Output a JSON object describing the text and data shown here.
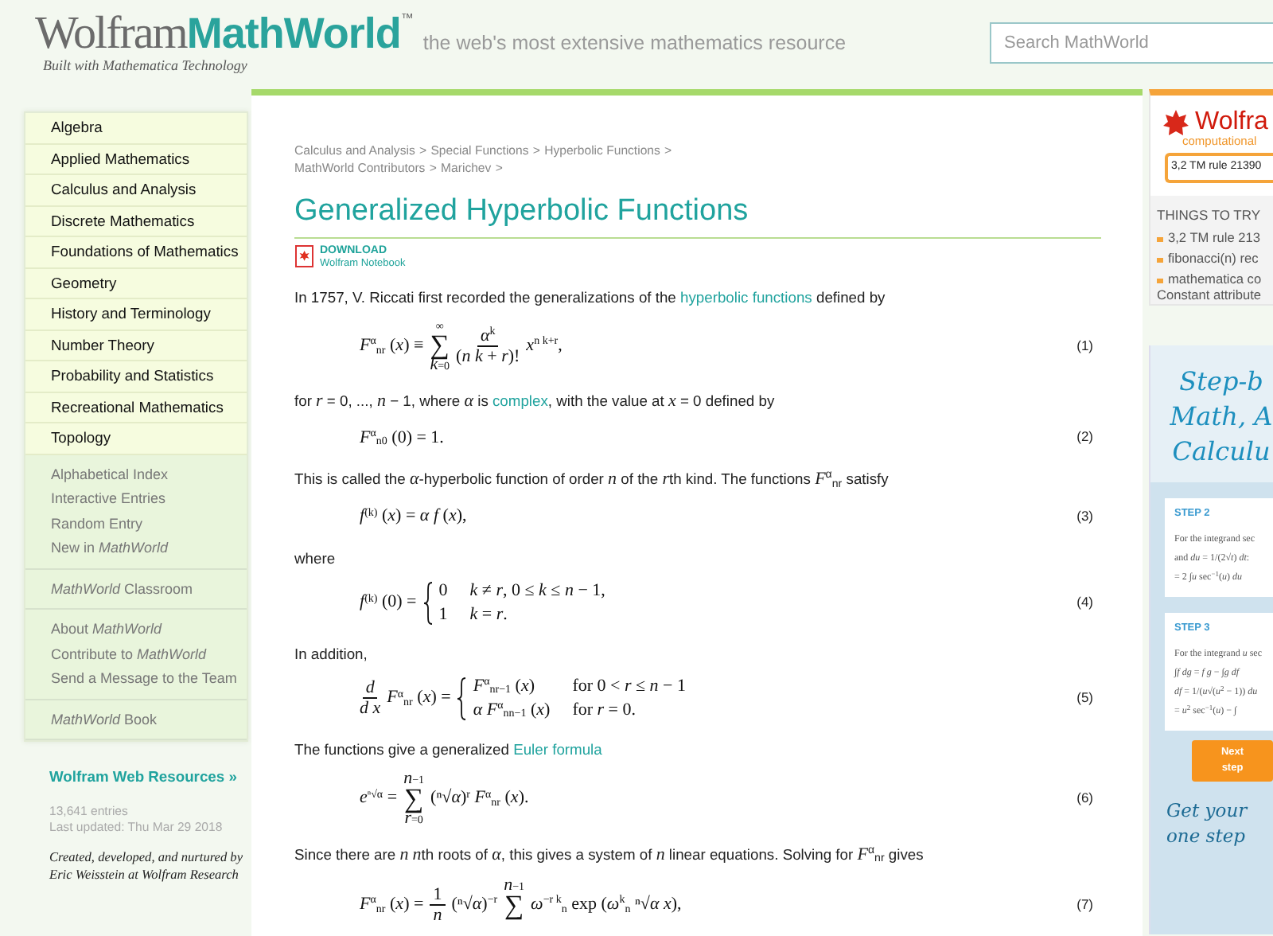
{
  "header": {
    "logo_wolfram": "Wolfram",
    "logo_mathworld": "MathWorld",
    "trademark": "™",
    "logo_tagline": "Built with Mathematica Technology",
    "tagline": "the web's most extensive mathematics resource",
    "search": {
      "placeholder": "Search MathWorld"
    }
  },
  "sidebar": {
    "topics": [
      "Algebra",
      "Applied Mathematics",
      "Calculus and Analysis",
      "Discrete Mathematics",
      "Foundations of Mathematics",
      "Geometry",
      "History and Terminology",
      "Number Theory",
      "Probability and Statistics",
      "Recreational Mathematics",
      "Topology"
    ],
    "link_groups": [
      [
        "Alphabetical Index",
        "Interactive Entries",
        "Random Entry",
        "New in *MathWorld*"
      ],
      [
        "*MathWorld* Classroom"
      ],
      [
        "About *MathWorld*",
        "Contribute to *MathWorld*",
        "Send a Message to the Team"
      ],
      [
        "*MathWorld* Book"
      ]
    ],
    "resources": "Wolfram Web Resources »",
    "entries": "13,641 entries",
    "updated": "Last updated: Thu Mar 29 2018",
    "credit": "Created, developed, and nurtured by Eric Weisstein at Wolfram Research"
  },
  "article": {
    "breadcrumb": [
      [
        {
          "label": "Calculus and Analysis",
          "separator": ">"
        },
        {
          "label": "Special Functions",
          "separator": ">"
        },
        {
          "label": "Hyperbolic Functions",
          "separator": ">"
        }
      ],
      [
        {
          "label": "MathWorld Contributors",
          "separator": ">"
        },
        {
          "label": "Marichev",
          "separator": ">"
        }
      ]
    ],
    "title": "Generalized Hyperbolic Functions",
    "download": {
      "label": "DOWNLOAD",
      "sublabel": "Wolfram Notebook"
    },
    "blocks": [
      {
        "kind": "para",
        "parts": [
          {
            "kind": "text",
            "text": "In 1757, V. Riccati first recorded the generalizations of the "
          },
          {
            "kind": "link",
            "text": "hyperbolic functions"
          },
          {
            "kind": "text",
            "text": " defined by"
          }
        ]
      },
      {
        "kind": "equation",
        "number": "(1)",
        "parts": [
          {
            "kind": "text",
            "text": "*F*$^{α}$$_{nr}$ (*x*) ≡"
          },
          {
            "kind": "sum",
            "symbol": "∑",
            "upper": "∞",
            "lower": "*k*=0"
          },
          {
            "kind": "frac",
            "num": "*α*$^{k}$",
            "den": "(*n k* + *r*)!"
          },
          {
            "kind": "text",
            "text": "*x*$^{n k+r}$,"
          }
        ]
      },
      {
        "kind": "para",
        "parts": [
          {
            "kind": "text",
            "text": "for *r* = 0, ..., *n* − 1, where *α* is "
          },
          {
            "kind": "link",
            "text": "complex"
          },
          {
            "kind": "text",
            "text": ", with the value at *x* = 0 defined by"
          }
        ]
      },
      {
        "kind": "equation",
        "number": "(2)",
        "parts": [
          {
            "kind": "text",
            "text": "*F*$^{α}$$_{n0}$ (0) = 1."
          }
        ]
      },
      {
        "kind": "para",
        "parts": [
          {
            "kind": "text",
            "text": "This is called the *α*-hyperbolic function of order *n* of the "
          },
          {
            "kind": "var",
            "text": "r"
          },
          {
            "kind": "text",
            "text": "th kind. The functions *F*$^{α}$$_{nr}$ satisfy"
          }
        ]
      },
      {
        "kind": "equation",
        "number": "(3)",
        "parts": [
          {
            "kind": "text",
            "text": "*f*$^{(k)}$ (*x*) = *α f* (*x*),"
          }
        ]
      },
      {
        "kind": "para",
        "parts": [
          {
            "kind": "text",
            "text": "where"
          }
        ]
      },
      {
        "kind": "equation",
        "number": "(4)",
        "parts": [
          {
            "kind": "text",
            "text": "*f*$^{(k)}$ (0) ="
          },
          {
            "kind": "cases",
            "rows": [
              [
                "0",
                "*k* ≠ *r*, 0 ≤ *k* ≤ *n* − 1,"
              ],
              [
                "1",
                "*k* = *r*."
              ]
            ]
          }
        ]
      },
      {
        "kind": "para",
        "parts": [
          {
            "kind": "text",
            "text": "In addition,"
          }
        ]
      },
      {
        "kind": "equation",
        "number": "(5)",
        "parts": [
          {
            "kind": "frac",
            "num": "*d*",
            "den": "*d x*"
          },
          {
            "kind": "text",
            "text": "*F*$^{α}$$_{nr}$ (*x*) ="
          },
          {
            "kind": "cases",
            "rows": [
              [
                "*F*$^{α}$$_{nr−1}$ (*x*)",
                "for 0 < *r* ≤ *n* − 1"
              ],
              [
                "*α F*$^{α}$$_{nn−1}$ (*x*)",
                "for *r* = 0."
              ]
            ]
          }
        ]
      },
      {
        "kind": "para",
        "parts": [
          {
            "kind": "text",
            "text": "The functions give a generalized "
          },
          {
            "kind": "link",
            "text": "Euler formula"
          }
        ]
      },
      {
        "kind": "equation",
        "number": "(6)",
        "parts": [
          {
            "kind": "text",
            "text": "*e*$^{ⁿ√α}$ ="
          },
          {
            "kind": "sum",
            "symbol": "∑",
            "upper": "*n*−1",
            "lower": "*r*=0"
          },
          {
            "kind": "text",
            "text": "(ⁿ√*α*)$^{r}$ *F*$^{α}$$_{nr}$ (*x*)."
          }
        ]
      },
      {
        "kind": "para",
        "parts": [
          {
            "kind": "text",
            "text": "Since there are *n* "
          },
          {
            "kind": "var",
            "text": "n"
          },
          {
            "kind": "text",
            "text": "th roots of *α*, this gives a system of *n* linear equations. Solving for *F*$^{α}$$_{nr}$ gives"
          }
        ]
      },
      {
        "kind": "equation",
        "number": "(7)",
        "parts": [
          {
            "kind": "text",
            "text": "*F*$^{α}$$_{nr}$ (*x*) ="
          },
          {
            "kind": "frac",
            "num": "1",
            "den": "*n*"
          },
          {
            "kind": "text",
            "text": "(ⁿ√*α*)$^{−r}$"
          },
          {
            "kind": "sum",
            "symbol": "∑",
            "upper": "*n*−1"
          },
          {
            "kind": "text",
            "text": "*ω*$^{−r k}$$_{n}$ exp (*ω*$^{k}$$_{n}$ ⁿ√*α* *x*),"
          }
        ]
      }
    ]
  },
  "alpha_widget": {
    "brand": "Wolfra",
    "brand_sub": "computational",
    "input_value": "3,2 TM rule 21390",
    "things_heading": "THINGS TO TRY",
    "things": [
      {
        "lines": [
          "3,2 TM rule 213"
        ]
      },
      {
        "lines": [
          "fibonacci(n) rec"
        ]
      },
      {
        "lines": [
          "mathematica co",
          "Constant attribute"
        ]
      }
    ]
  },
  "ad": {
    "headline": [
      "Step-b",
      "Math, A",
      "Calculu"
    ],
    "steps": [
      {
        "label": "STEP 2",
        "lines": [
          "For the integrand sec",
          "and *du* = 1/(2√*t*) *dt*:",
          "= 2 ∫*u* sec$^{−1}$(*u*) *du*"
        ]
      },
      {
        "label": "STEP 3",
        "lines": [
          "For the integrand *u* sec",
          "∫*f dg* = *f g* − ∫*g df*",
          "*df* = 1/(*u*√(*u*$^{2}$ − 1)) *du*",
          "= *u*$^{2}$ sec$^{−1}$(*u*) − ∫"
        ]
      }
    ],
    "button": "Next step",
    "footer": [
      "Get your",
      "one step"
    ]
  }
}
